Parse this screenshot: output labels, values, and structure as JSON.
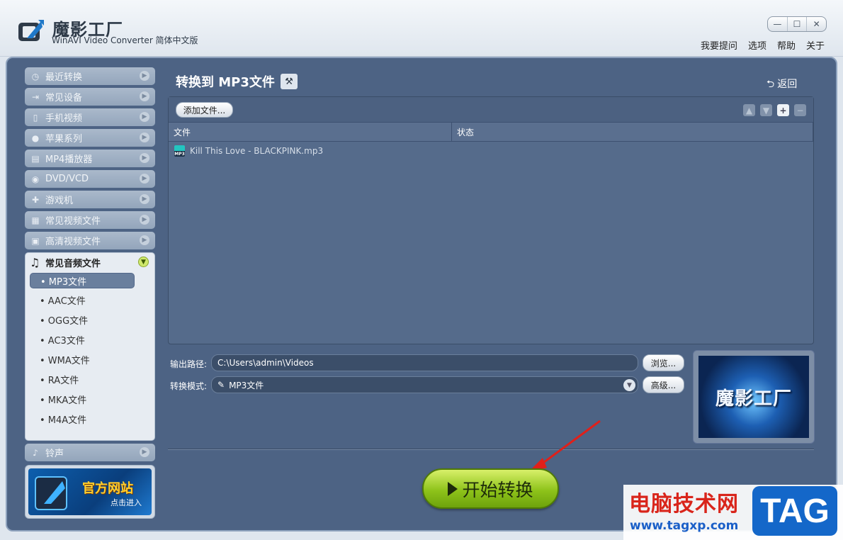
{
  "app": {
    "title": "魔影工厂",
    "subtitle": "WinAVI Video Converter 简体中文版"
  },
  "window_controls": [
    "minimize-icon",
    "maximize-icon",
    "close-icon"
  ],
  "top_menu": [
    "我要提问",
    "选项",
    "帮助",
    "关于"
  ],
  "sidebar": {
    "categories": [
      {
        "label": "最近转换",
        "icon": "clock-icon"
      },
      {
        "label": "常见设备",
        "icon": "device-icon"
      },
      {
        "label": "手机视频",
        "icon": "phone-icon"
      },
      {
        "label": "苹果系列",
        "icon": "apple-icon"
      },
      {
        "label": "MP4播放器",
        "icon": "mp4-player-icon"
      },
      {
        "label": "DVD/VCD",
        "icon": "disc-icon"
      },
      {
        "label": "游戏机",
        "icon": "gamepad-icon"
      },
      {
        "label": "常见视频文件",
        "icon": "film-icon"
      },
      {
        "label": "高清视频文件",
        "icon": "hd-icon"
      }
    ],
    "open_category": {
      "label": "常见音频文件",
      "icon": "music-note-icon",
      "items": [
        "• MP3文件",
        "• AAC文件",
        "• OGG文件",
        "• AC3文件",
        "• WMA文件",
        "• RA文件",
        "• MKA文件",
        "• M4A文件"
      ],
      "selected_index": 0
    },
    "ringtone": {
      "label": "铃声",
      "icon": "bell-icon"
    },
    "site_banner": {
      "title": "官方网站",
      "subtitle": "点击进入"
    }
  },
  "content": {
    "title": "转换到 MP3文件",
    "back_label": "返回",
    "add_file_label": "添加文件...",
    "columns": [
      "文件",
      "状态"
    ],
    "files": [
      {
        "name": "Kill This Love - BLACKPINK.mp3",
        "status": ""
      }
    ],
    "output_path_label": "输出路径:",
    "output_path_value": "C:\\Users\\admin\\Videos",
    "browse_label": "浏览...",
    "mode_label": "转换模式:",
    "mode_value": "MP3文件",
    "advanced_label": "高级...",
    "preview_text": "魔影工厂",
    "start_label": "开始转换"
  },
  "watermark": {
    "site_cn": "电脑技术网",
    "url": "www.tagxp.com",
    "tag": "TAG"
  },
  "colors": {
    "frame_bg": "#4d6384",
    "start_button": "#8ec31a",
    "accent_red": "#d9251b",
    "tag_blue": "#1467c9"
  }
}
